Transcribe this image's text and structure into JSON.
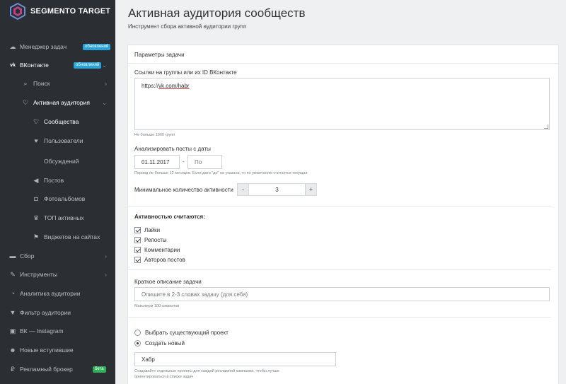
{
  "brand": {
    "name": "SEGMENTO TARGET"
  },
  "sidebar": {
    "items": [
      {
        "label": "Менеджер задач",
        "icon": "cloud-icon",
        "badge": "обновлений",
        "badge_color": "#2aa3d8"
      },
      {
        "label": "ВКонтакте",
        "icon": "vk-icon",
        "badge": "обновлений",
        "badge_color": "#2aa3d8",
        "chevron": "⌄"
      },
      {
        "label": "Поиск",
        "icon": "search-icon",
        "chevron": "›"
      },
      {
        "label": "Активная аудитория",
        "icon": "heart-outline-icon",
        "chevron": "⌄"
      },
      {
        "label": "Сообщества",
        "icon": "heart-outline-icon"
      },
      {
        "label": "Пользователи",
        "icon": "heart-icon"
      },
      {
        "label": "Обсуждений",
        "icon": ""
      },
      {
        "label": "Постов",
        "icon": "megaphone-icon"
      },
      {
        "label": "Фотоальбомов",
        "icon": "camera-icon"
      },
      {
        "label": "ТОП активных",
        "icon": "trophy-icon"
      },
      {
        "label": "Виджетов на сайтах",
        "icon": "flag-icon"
      },
      {
        "label": "Сбор",
        "icon": "car-icon",
        "chevron": "›"
      },
      {
        "label": "Инструменты",
        "icon": "wrench-icon",
        "chevron": "›"
      },
      {
        "label": "Аналитика аудитории",
        "icon": "pie-chart-icon"
      },
      {
        "label": "Фильтр аудитории",
        "icon": "filter-icon"
      },
      {
        "label": "ВК — Instagram",
        "icon": "image-icon"
      },
      {
        "label": "Новые вступившие",
        "icon": "users-icon"
      },
      {
        "label": "Рекламный брокер",
        "icon": "ruble-icon",
        "badge": "бета",
        "badge_color": "#2fb05a"
      }
    ]
  },
  "header": {
    "title": "Активная аудитория сообществ",
    "subtitle": "Инструмент сбора активной аудитории групп"
  },
  "form": {
    "panel_title": "Параметры задачи",
    "links_label": "Ссылки на группы или их ID ВКонтакте",
    "links_value_prefix": "https://",
    "links_value_link": "vk.com/habr",
    "links_hint": "Не больше 1000 групп",
    "date_label": "Анализировать посты с даты",
    "date_from": "01.11.2017",
    "date_sep": "-",
    "date_to_placeholder": "По",
    "date_hint": "Период не больше 12 месяцев. Если дата \"до\" не указана, то по умолчанию считается текущая",
    "min_activity_label": "Минимальное количество активности",
    "min_activity_value": "3",
    "minus": "-",
    "plus": "+",
    "activity_title": "Активностью считаются:",
    "activities": [
      "Лайки",
      "Репосты",
      "Комментарии",
      "Авторов постов"
    ],
    "desc_label": "Краткое описание задачи",
    "desc_placeholder": "Опишите в 2-3 словах задачу (для себя)",
    "desc_hint": "Максимум 100 символов",
    "project_options": [
      "Выбрать существующий проект",
      "Создать новый"
    ],
    "project_selected_index": 1,
    "project_name": "Хабр",
    "project_hint_1": "Создавайте отдельные проекты для каждой рекламной кампании, чтобы лучше",
    "project_hint_2": "ориентироваться в списке задач"
  }
}
